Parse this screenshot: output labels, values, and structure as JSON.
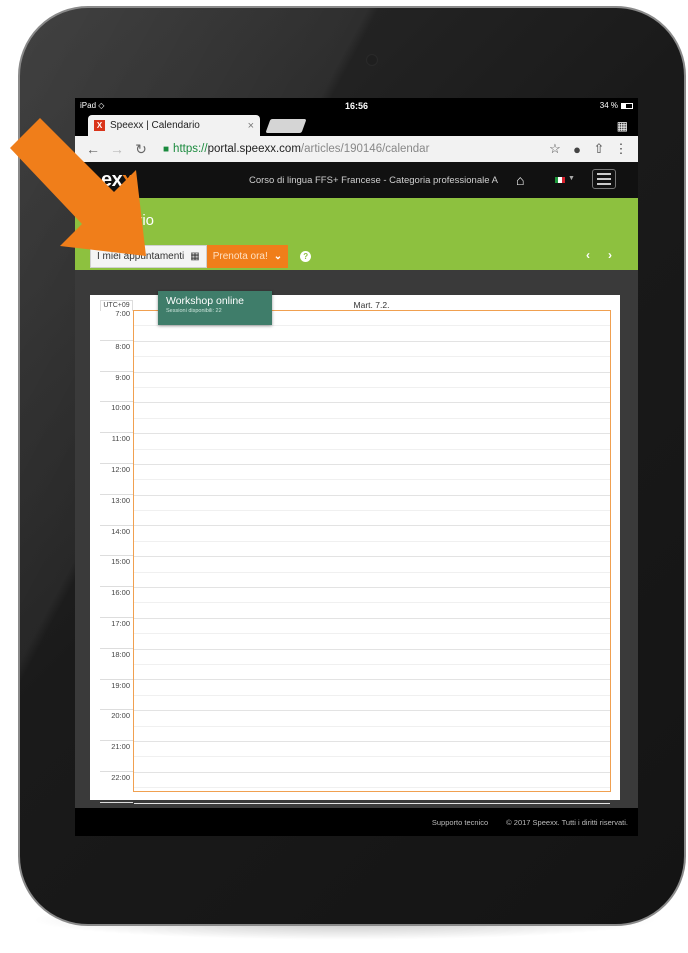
{
  "status_bar": {
    "device": "iPad",
    "wifi_icon": "wifi-icon",
    "time": "16:56",
    "battery": "34 %"
  },
  "browser": {
    "tab_title": "Speexx | Calendario",
    "tab_close": "×",
    "favicon_letter": "X",
    "url_scheme": "https://",
    "url_host": "portal.speexx.com",
    "url_path": "/articles/190146/calendar"
  },
  "site": {
    "logo_main": "ex",
    "logo_accent": "x",
    "course_name": "Corso di lingua FFS+ Francese - Categoria professionale A",
    "page_title": "ario"
  },
  "toolbar": {
    "my_appointments": "I miei appuntamenti",
    "book_now": "Prenota ora!"
  },
  "calendar": {
    "timezone": "UTC+09",
    "day_header": "Mart. 7.2.",
    "hours": [
      "7:00",
      "8:00",
      "9:00",
      "10:00",
      "11:00",
      "12:00",
      "13:00",
      "14:00",
      "15:00",
      "16:00",
      "17:00",
      "18:00",
      "19:00",
      "20:00",
      "21:00",
      "22:00"
    ],
    "dropdown_item_title": "Workshop online",
    "dropdown_item_sub": "Sessioni disponibili: 22"
  },
  "footer": {
    "support": "Supporto tecnico",
    "copyright": "© 2017 Speexx. Tutti i diritti riservati."
  },
  "colors": {
    "accent_green": "#8dc13f",
    "accent_orange": "#f07e1a",
    "popup_green": "#3f7d6a"
  }
}
